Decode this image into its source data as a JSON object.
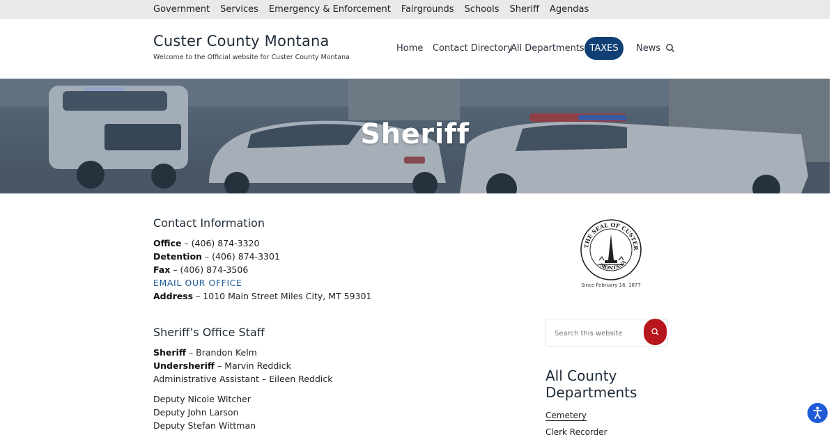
{
  "topnav": [
    "Government",
    "Services",
    "Emergency & Enforcement",
    "Fairgrounds",
    "Schools",
    "Sheriff",
    "Agendas"
  ],
  "site": {
    "title": "Custer County Montana",
    "tagline": "Welcome to the Official website for Custer County Montana"
  },
  "mainnav": {
    "home": "Home",
    "contact": "Contact Directory",
    "departments": "All Departments",
    "taxes": "TAXES",
    "news": "News"
  },
  "hero": {
    "title": "Sheriff"
  },
  "contact": {
    "heading": "Contact Information",
    "office_label": "Office",
    "office_value": " – (406) 874-3320",
    "detention_label": "Detention",
    "detention_value": " – (406) 874-3301",
    "fax_label": "Fax",
    "fax_value": " – (406) 874-3506",
    "email_link": "EMAIL OUR OFFICE",
    "address_label": "Address",
    "address_value": " – 1010 Main Street Miles City, MT 59301"
  },
  "staff": {
    "heading": "Sheriff’s Office Staff",
    "sheriff_label": "Sheriff",
    "sheriff_value": " – Brandon Kelm",
    "under_label": "Undersheriff",
    "under_value": " – Marvin Reddick",
    "admin": "Administrative Assistant – Eileen Reddick",
    "deputies": [
      "Deputy Nicole Witcher",
      "Deputy John Larson",
      "Deputy Stefan Wittman"
    ]
  },
  "seal": {
    "caption": "Since February 16, 1877",
    "ring_text": "THE SEAL OF CUSTER COUNTY",
    "bottom_text": "MONTANA"
  },
  "sidebar": {
    "search_placeholder": "Search this website",
    "title": "All County Departments",
    "links": [
      "Cemetery",
      "Clerk Recorder"
    ]
  },
  "colors": {
    "accent": "#0f3f73",
    "search_button": "#b7161c",
    "link": "#1a5a97",
    "a11y": "#1f5bd6"
  }
}
